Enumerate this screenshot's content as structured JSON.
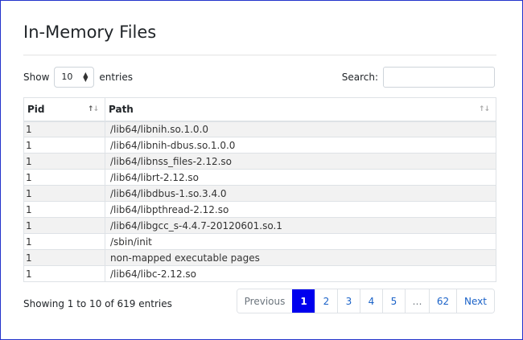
{
  "page": {
    "title": "In-Memory Files"
  },
  "length": {
    "show_label": "Show",
    "selected": "10",
    "entries_label": "entries"
  },
  "search": {
    "label": "Search:",
    "value": "",
    "placeholder": ""
  },
  "table": {
    "columns": [
      "Pid",
      "Path"
    ],
    "rows": [
      {
        "pid": "1",
        "path": "/lib64/libnih.so.1.0.0"
      },
      {
        "pid": "1",
        "path": "/lib64/libnih-dbus.so.1.0.0"
      },
      {
        "pid": "1",
        "path": "/lib64/libnss_files-2.12.so"
      },
      {
        "pid": "1",
        "path": "/lib64/librt-2.12.so"
      },
      {
        "pid": "1",
        "path": "/lib64/libdbus-1.so.3.4.0"
      },
      {
        "pid": "1",
        "path": "/lib64/libpthread-2.12.so"
      },
      {
        "pid": "1",
        "path": "/lib64/libgcc_s-4.4.7-20120601.so.1"
      },
      {
        "pid": "1",
        "path": "/sbin/init"
      },
      {
        "pid": "1",
        "path": "non-mapped executable pages"
      },
      {
        "pid": "1",
        "path": "/lib64/libc-2.12.so"
      }
    ]
  },
  "footer": {
    "info": "Showing 1 to 10 of 619 entries"
  },
  "pagination": {
    "previous": "Previous",
    "pages": [
      "1",
      "2",
      "3",
      "4",
      "5"
    ],
    "ellipsis": "…",
    "last": "62",
    "next": "Next",
    "active": "1",
    "active_color": "#0000ee"
  }
}
